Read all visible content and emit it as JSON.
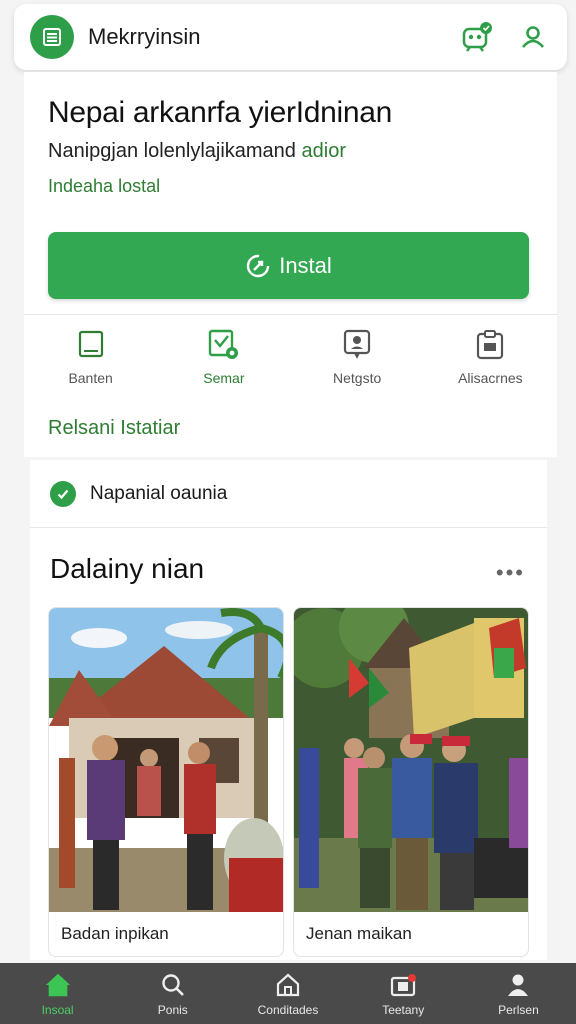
{
  "colors": {
    "brand_green": "#2e9e48",
    "accent_green": "#2e7d32",
    "nav_bg": "#4a4a4a"
  },
  "header": {
    "title": "Mekrryinsin",
    "logo_icon": "list-icon",
    "icons": [
      "robot-face-icon",
      "user-icon"
    ]
  },
  "hero": {
    "headline": "Nepai arkanrfa yierIdninan",
    "subline": "Nanipgjan lolenlylajikamand",
    "subline_accent": "adior",
    "link": "Indeaha lostal",
    "install_label": "Instal",
    "actions": [
      {
        "label": "Banten",
        "icon": "tablet-icon"
      },
      {
        "label": "Semar",
        "icon": "verified-doc-icon",
        "active": true
      },
      {
        "label": "Netgsto",
        "icon": "chat-support-icon"
      },
      {
        "label": "Alisacrnes",
        "icon": "clipboard-icon"
      }
    ],
    "footer_link": "Relsani Istatiar"
  },
  "status": {
    "text": "Napanial oaunia"
  },
  "gallery": {
    "title": "Dalainy nian",
    "items": [
      {
        "caption": "Badan inpikan"
      },
      {
        "caption": "Jenan maikan"
      }
    ]
  },
  "bottom_nav": [
    {
      "label": "Insoal",
      "icon": "home-icon",
      "active": true
    },
    {
      "label": "Ponis",
      "icon": "search-icon"
    },
    {
      "label": "Conditades",
      "icon": "house-outline-icon"
    },
    {
      "label": "Teetany",
      "icon": "camera-icon"
    },
    {
      "label": "Perlsen",
      "icon": "person-icon"
    }
  ]
}
